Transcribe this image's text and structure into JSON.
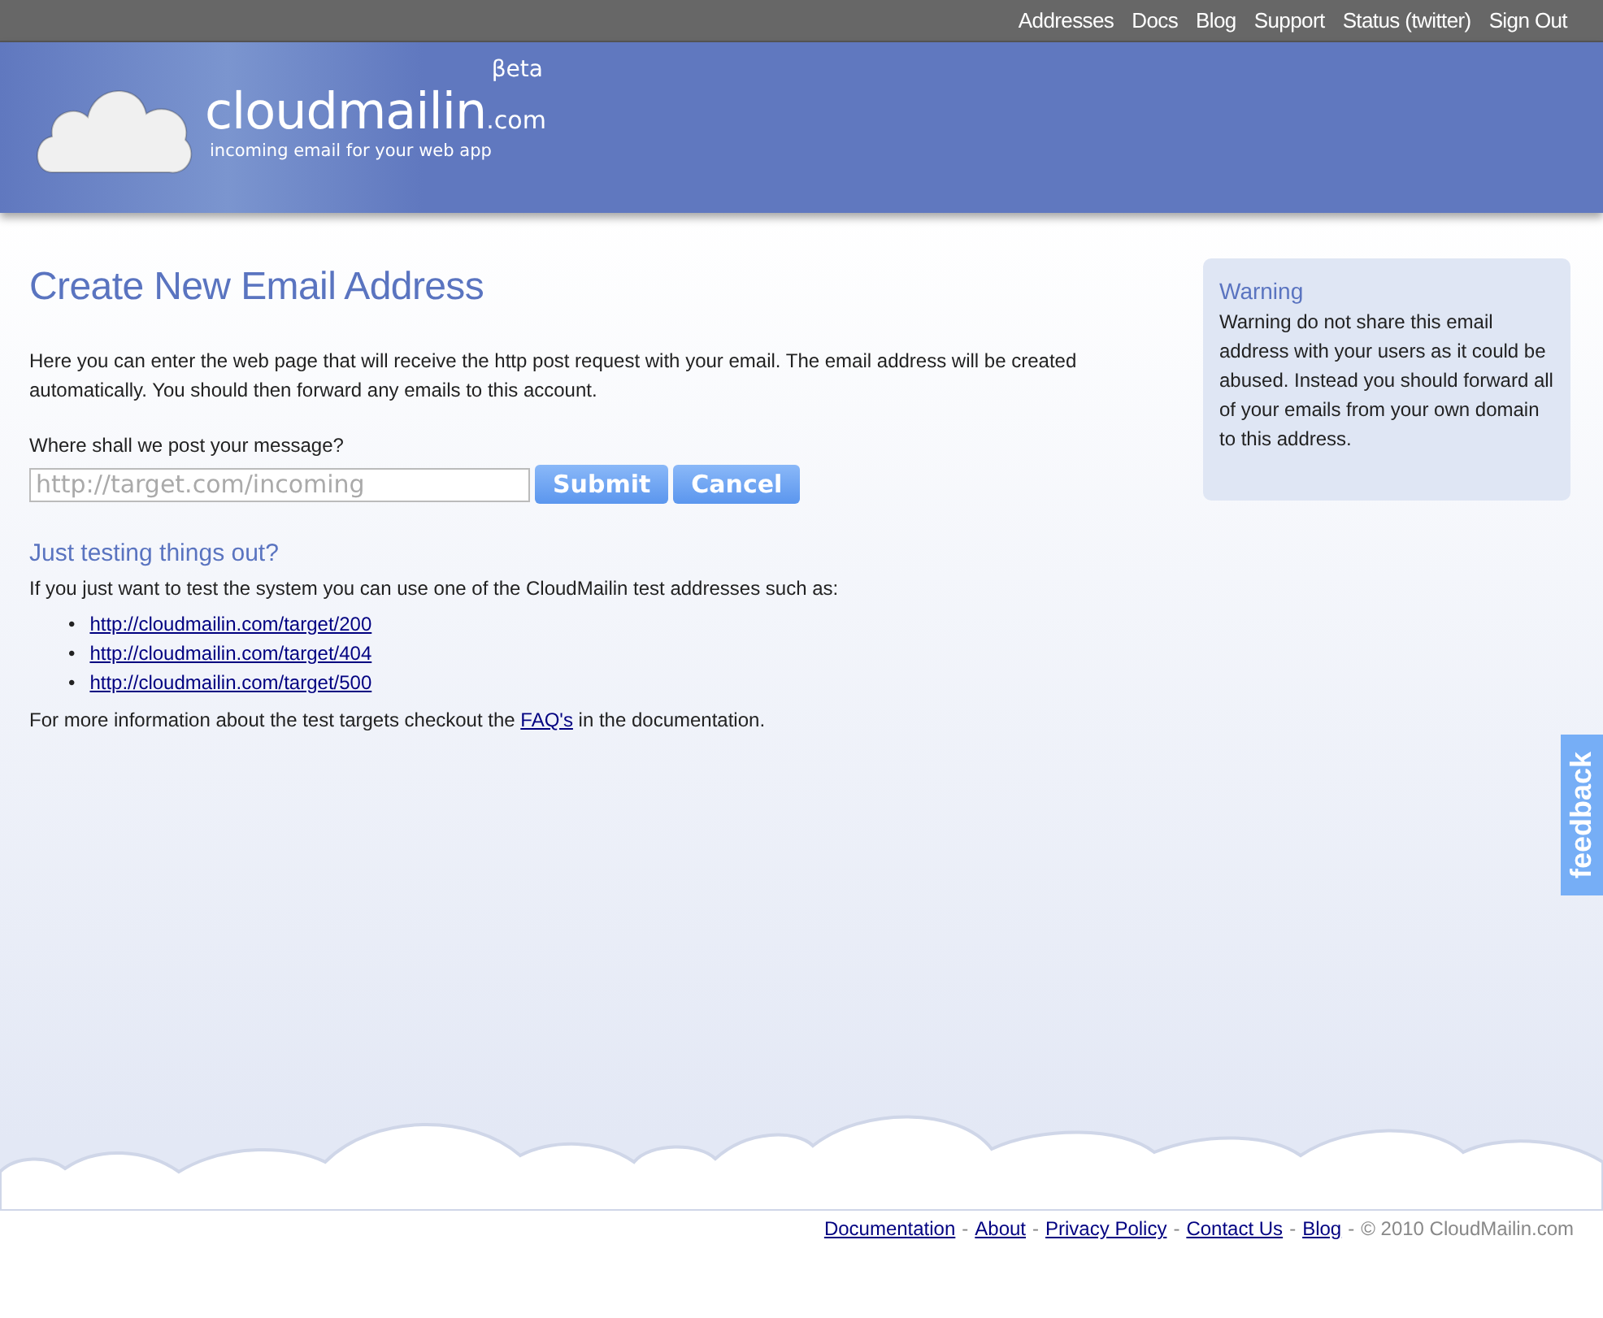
{
  "top_nav": [
    {
      "label": "Addresses"
    },
    {
      "label": "Docs"
    },
    {
      "label": "Blog"
    },
    {
      "label": "Support"
    },
    {
      "label": "Status (twitter)"
    },
    {
      "label": "Sign Out"
    }
  ],
  "logo": {
    "name": "cloudmailin",
    "suffix": ".com",
    "badge": "βeta",
    "tagline": "incoming email for your web app"
  },
  "form": {
    "title": "Create New Email Address",
    "intro": "Here you can enter the web page that will receive the http post request with your email. The email address will be created automatically. You should then forward any emails to this account.",
    "label": "Where shall we post your message?",
    "placeholder": "http://target.com/incoming",
    "buttons": [
      "Submit",
      "Cancel"
    ]
  },
  "testing": {
    "title": "Just testing things out?",
    "text": "If you just want to test the system you can use one of the CloudMailin test addresses such as:",
    "links": [
      {
        "bullet": "•",
        "url": "http://cloudmailin.com/target/200"
      },
      {
        "bullet": "•",
        "url": "http://cloudmailin.com/target/404"
      },
      {
        "bullet": "•",
        "url": "http://cloudmailin.com/target/500"
      }
    ],
    "more_info": {
      "before": "For more information about the test targets checkout the ",
      "link": "FAQ's",
      "after": " in the documentation."
    }
  },
  "warning": {
    "title": "Warning",
    "text": "Warning do not share this email address with your users as it could be abused. Instead you should forward all of your emails from your own domain to this address."
  },
  "feedback": {
    "label": "feedback"
  },
  "footer": [
    {
      "kind": "link",
      "text": "Documentation"
    },
    {
      "kind": "separator",
      "text": "-"
    },
    {
      "kind": "link",
      "text": "About"
    },
    {
      "kind": "separator",
      "text": "-"
    },
    {
      "kind": "link",
      "text": "Privacy Policy"
    },
    {
      "kind": "separator",
      "text": "-"
    },
    {
      "kind": "link",
      "text": "Contact Us"
    },
    {
      "kind": "separator",
      "text": "-"
    },
    {
      "kind": "link",
      "text": "Blog"
    },
    {
      "kind": "separator",
      "text": "-"
    },
    {
      "kind": "copyright",
      "text": "© 2010 CloudMailin.com"
    }
  ]
}
